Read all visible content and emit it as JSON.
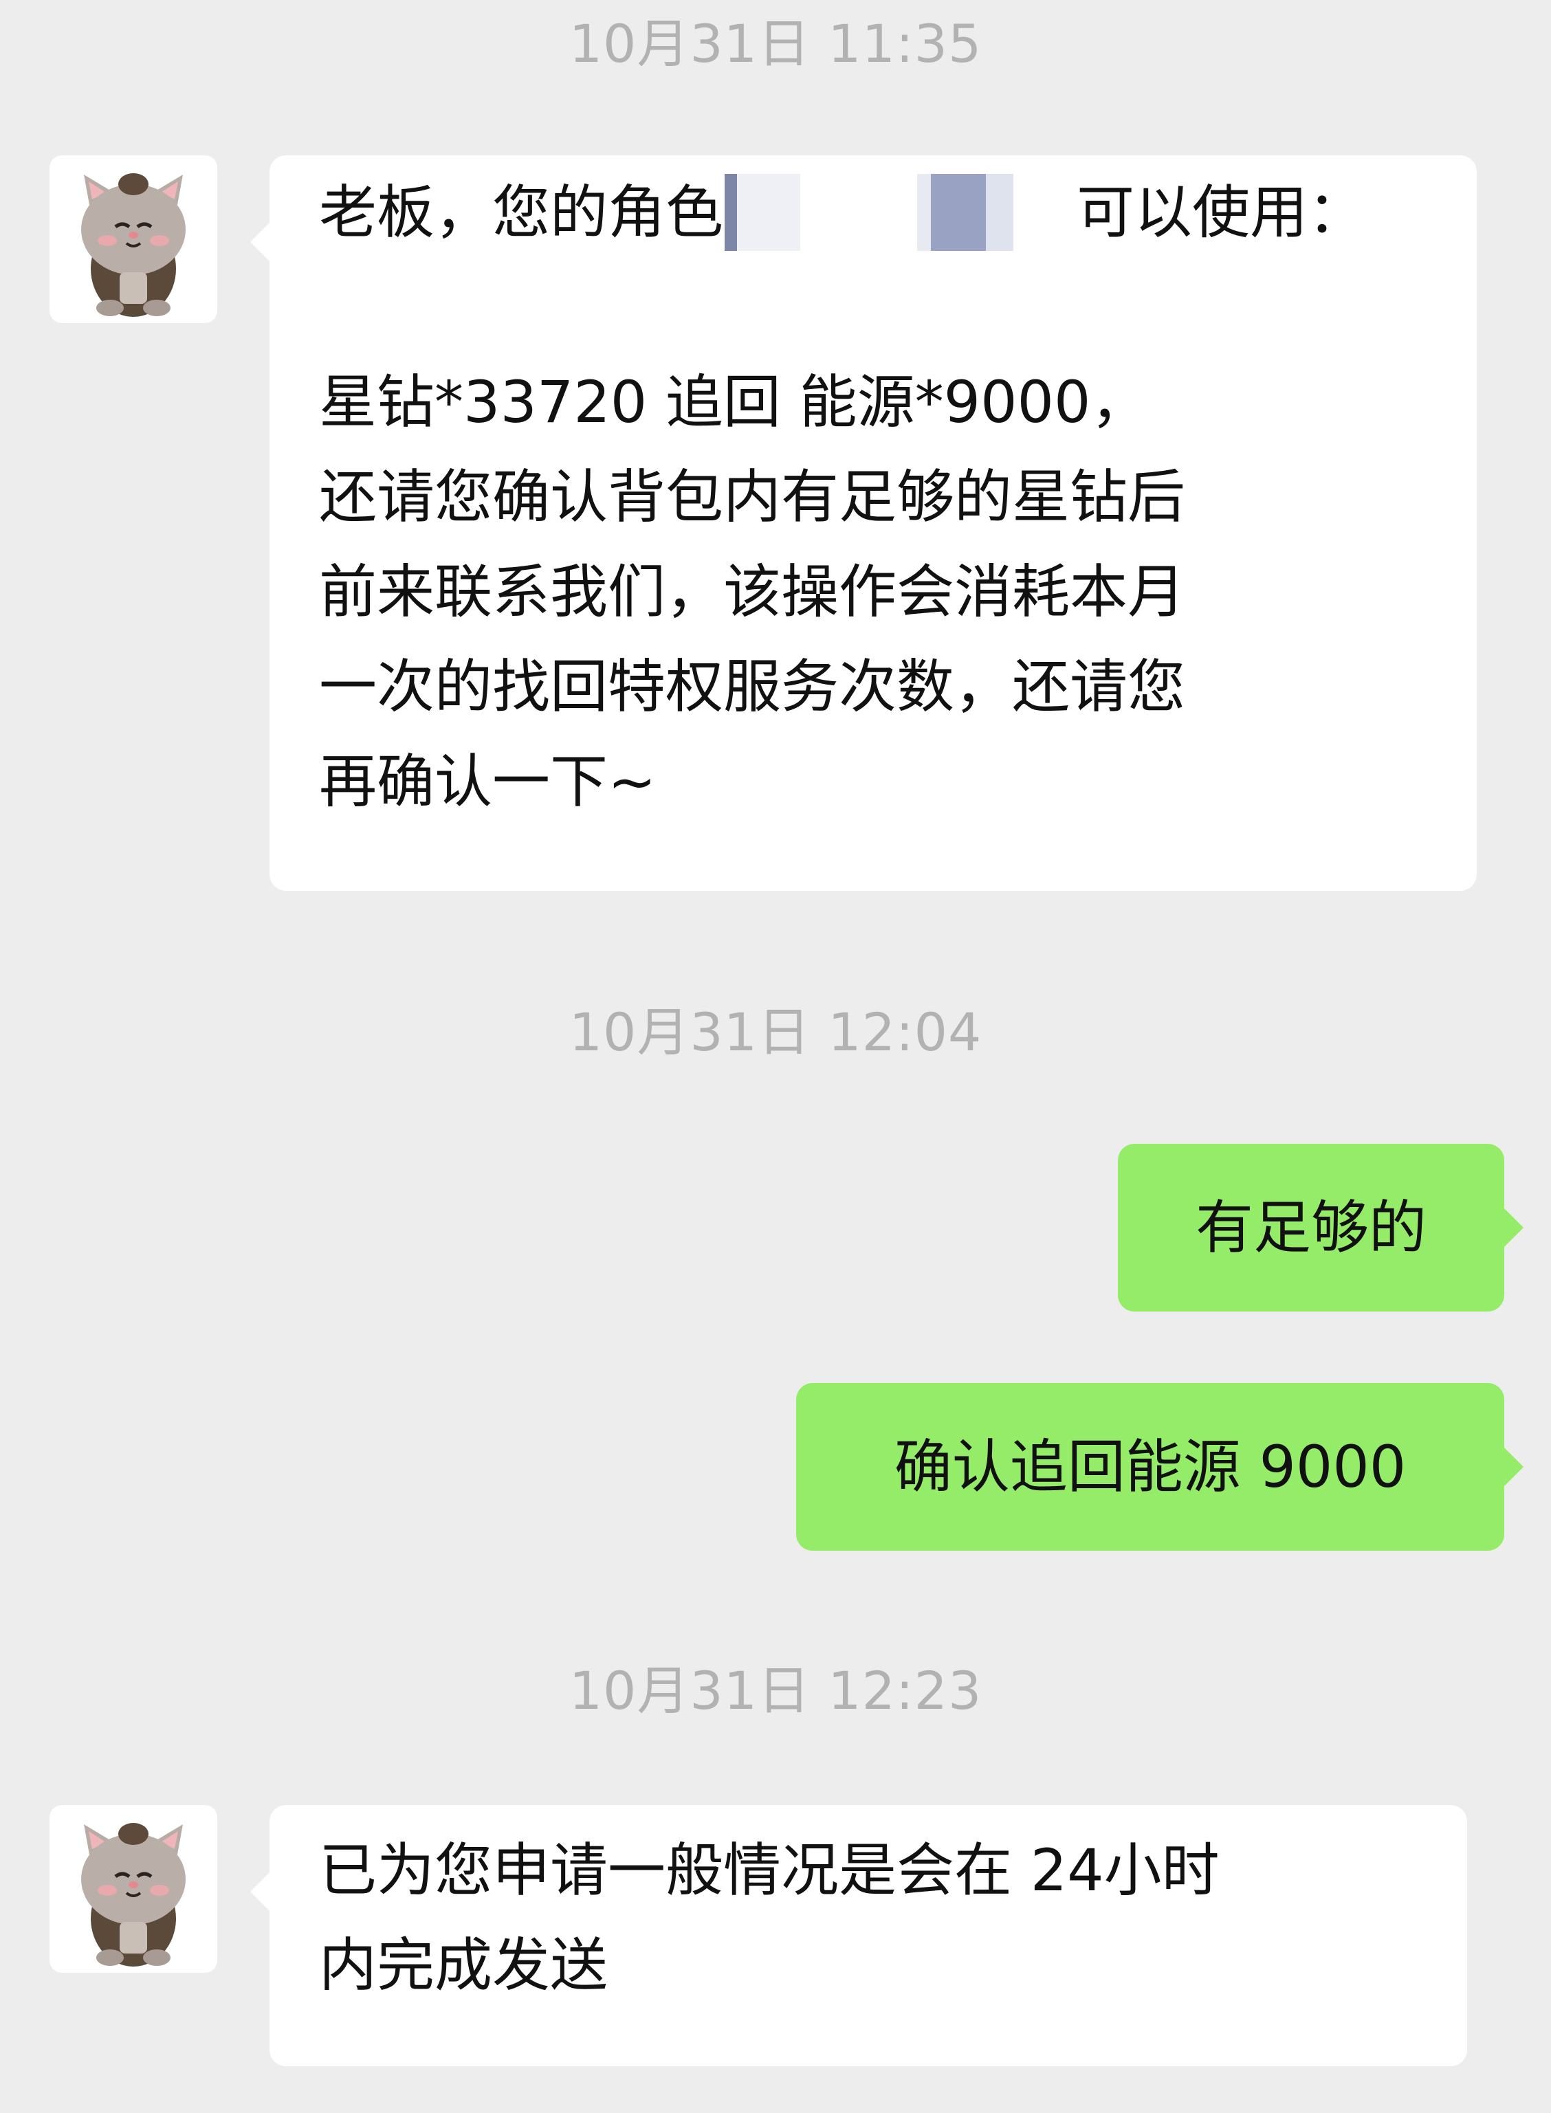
{
  "chat": {
    "timestamps": [
      "10月31日 11:35",
      "10月31日 12:04",
      "10月31日 12:23"
    ],
    "messages": [
      {
        "sender": "agent",
        "lines": [
          "老板，您的角色",
          "可以使用：",
          "星钻*33720 追回 能源*9000，",
          "还请您确认背包内有足够的星钻后",
          "前来联系我们，该操作会消耗本月",
          "一次的找回特权服务次数，还请您",
          "再确认一下~"
        ]
      },
      {
        "sender": "user",
        "text": "有足够的"
      },
      {
        "sender": "user",
        "text": "确认追回能源 9000"
      },
      {
        "sender": "agent",
        "lines": [
          "已为您申请一般情况是会在 24小时",
          "内完成发送"
        ]
      }
    ]
  },
  "avatar": {
    "icon": "hamster-avatar-icon"
  },
  "colors": {
    "background": "#ededed",
    "incoming_bubble": "#ffffff",
    "outgoing_bubble": "#95ec69",
    "timestamp": "#b2b2b2",
    "text": "#111111"
  }
}
